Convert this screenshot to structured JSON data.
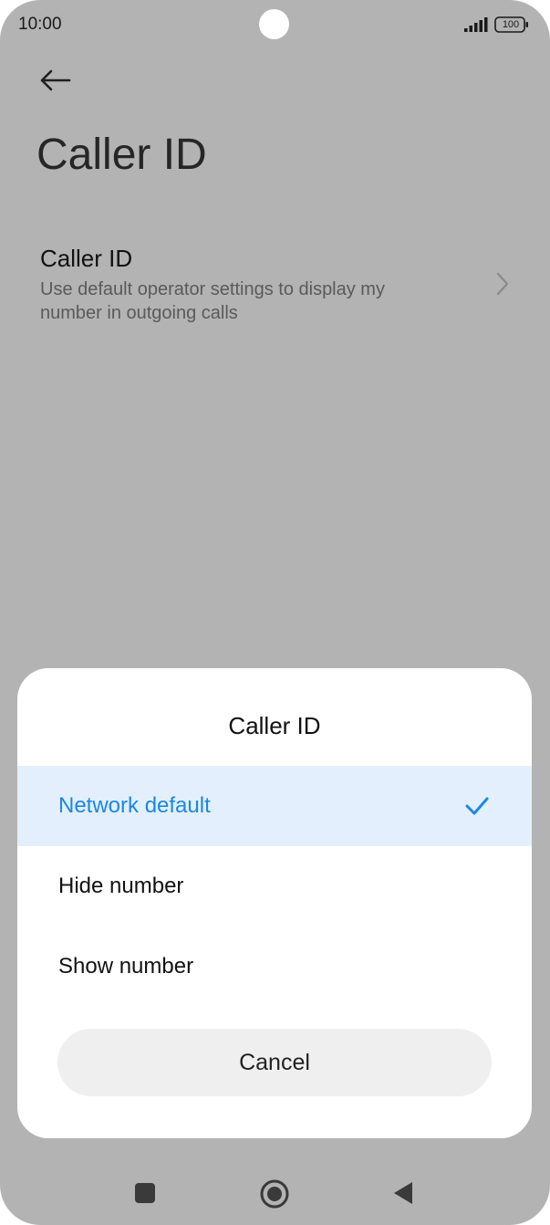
{
  "status_bar": {
    "time": "10:00",
    "battery_level": "100",
    "icons": [
      "signal-icon",
      "battery-icon"
    ]
  },
  "header": {
    "back_icon": "back-arrow-icon",
    "title": "Caller ID"
  },
  "setting": {
    "title": "Caller ID",
    "subtitle": "Use default operator settings to display my number in outgoing calls",
    "chevron_icon": "chevron-right-icon"
  },
  "dialog": {
    "title": "Caller ID",
    "options": [
      {
        "label": "Network default",
        "selected": true
      },
      {
        "label": "Hide number",
        "selected": false
      },
      {
        "label": "Show number",
        "selected": false
      }
    ],
    "cancel_label": "Cancel"
  },
  "nav_bar": {
    "icons": [
      "recents-icon",
      "home-icon",
      "back-icon"
    ]
  },
  "colors": {
    "scrim_background": "#b3b3b3",
    "selected_row_background": "#e3effc",
    "accent": "#1a88e6",
    "cancel_button_background": "#efefef"
  }
}
